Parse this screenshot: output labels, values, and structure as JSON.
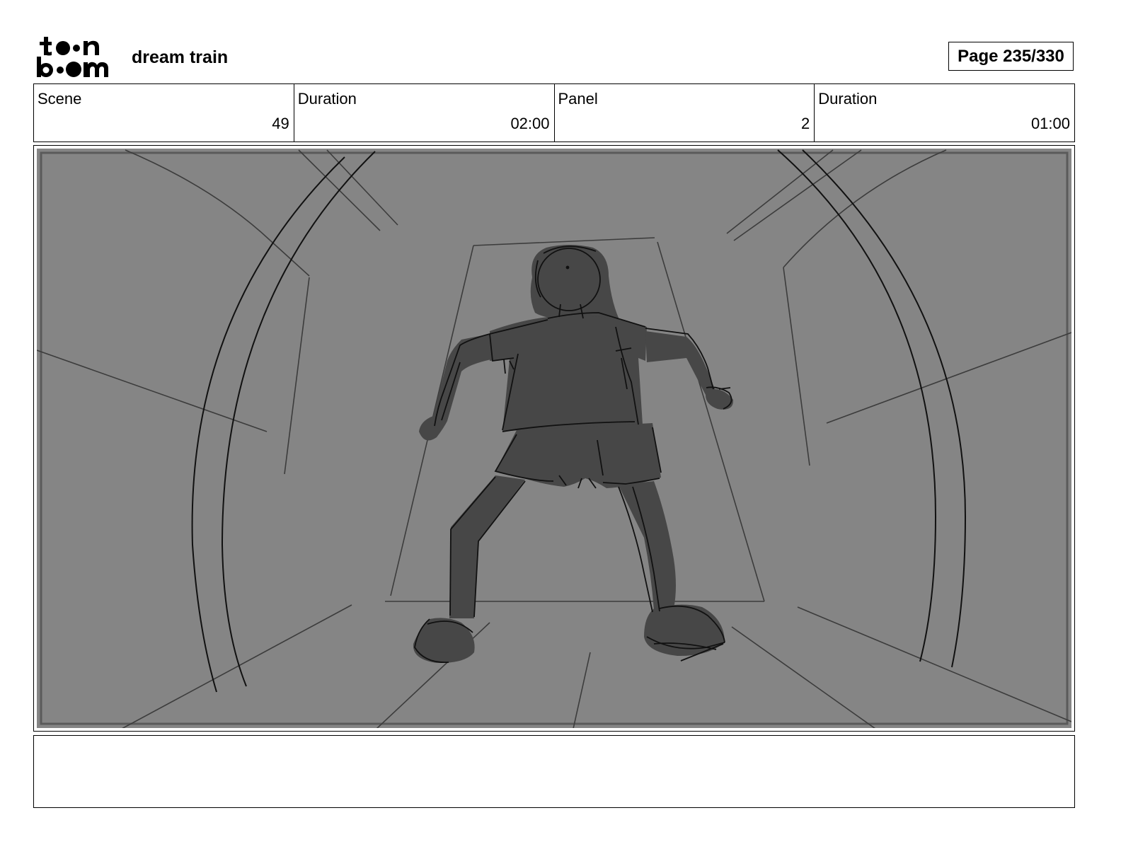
{
  "header": {
    "logo_top": "t  n",
    "logo_bottom": "b  m",
    "project_title": "dream train",
    "page_label": "Page 235/330"
  },
  "info": [
    {
      "label": "Scene",
      "value": "49"
    },
    {
      "label": "Duration",
      "value": "02:00"
    },
    {
      "label": "Panel",
      "value": "2"
    },
    {
      "label": "Duration",
      "value": "01:00"
    }
  ],
  "panel": {
    "background": "#858585",
    "figure_fill": "#474747",
    "line_color": "#1a1a1a",
    "notes": ""
  }
}
